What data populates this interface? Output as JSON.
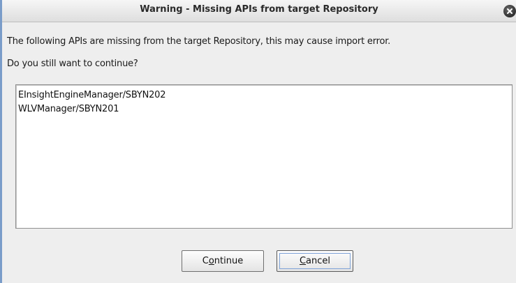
{
  "dialog": {
    "title": "Warning - Missing APIs from target Repository",
    "message_line1": "The following APIs are missing from the target Repository, this may cause import error.",
    "message_line2": "Do you still want to continue?",
    "missing_apis": [
      "EInsightEngineManager/SBYN202",
      "WLVManager/SBYN201"
    ],
    "close_icon": "close-icon"
  },
  "buttons": {
    "continue": {
      "mnemonic": "o",
      "before": "C",
      "after": "ntinue"
    },
    "cancel": {
      "mnemonic": "C",
      "before": "",
      "after": "ancel"
    }
  }
}
